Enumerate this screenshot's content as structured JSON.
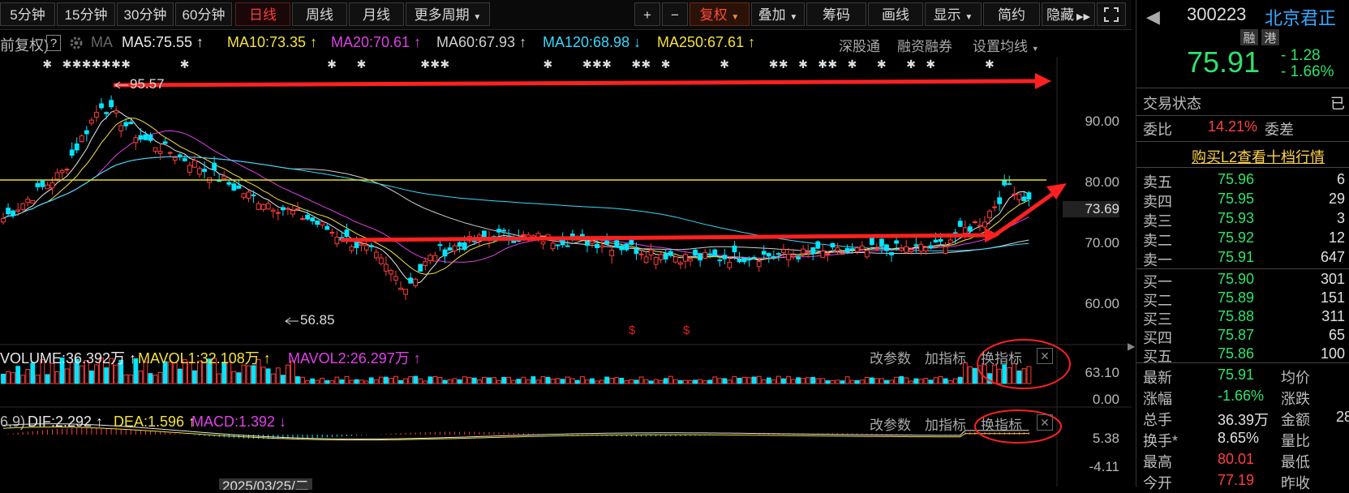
{
  "toolbar": {
    "periods": [
      "5分钟",
      "15分钟",
      "30分钟",
      "60分钟",
      "日线",
      "周线",
      "月线",
      "更多周期"
    ],
    "active_period": "日线",
    "plus": "+",
    "minus": "−",
    "fuquan": "复权",
    "diejia": "叠加",
    "chouma": "筹码",
    "huaxian": "画线",
    "xianshi": "显示",
    "jianyue": "简约",
    "yincang": "隐藏"
  },
  "ma_bar": {
    "prefix": "前复权)",
    "help": "?",
    "ma_label": "MA",
    "items": [
      {
        "text": "MA5:75.55 ↑",
        "color": "#e8e8e8"
      },
      {
        "text": "MA10:73.35 ↑",
        "color": "#f5e13c"
      },
      {
        "text": "MA20:70.61 ↑",
        "color": "#e040e8"
      },
      {
        "text": "MA60:67.93 ↑",
        "color": "#d0d0d0"
      },
      {
        "text": "MA120:68.98 ↓",
        "color": "#38d8ff"
      },
      {
        "text": "MA250:67.61 ↑",
        "color": "#f5e13c"
      }
    ],
    "links": [
      "深股通",
      "融资融券",
      "设置均线"
    ]
  },
  "price_chart": {
    "high_label": "95.57",
    "low_label": "56.85",
    "axis": [
      "90.00",
      "80.00",
      "73.69",
      "70.00",
      "60.00"
    ],
    "s_marks": [
      "$",
      "$"
    ]
  },
  "volume_panel": {
    "items": [
      {
        "text": "VOLUME:36.392万 ↑",
        "color": "#e8e8e8"
      },
      {
        "text": "MAVOL1:32.108万 ↑",
        "color": "#f5e13c"
      },
      {
        "text": "MAVOL2:26.297万 ↑",
        "color": "#e040e8"
      }
    ],
    "buttons": [
      "改参数",
      "加指标",
      "换指标"
    ],
    "axis": [
      "63.10",
      "0.00"
    ]
  },
  "macd_panel": {
    "prefix": "6,9)",
    "items": [
      {
        "text": "DIF:2.292 ↑",
        "color": "#e8e8e8"
      },
      {
        "text": "DEA:1.596 ↑",
        "color": "#f5e13c"
      },
      {
        "text": "MACD:1.392 ↓",
        "color": "#e040e8"
      }
    ],
    "buttons": [
      "改参数",
      "加指标",
      "换指标"
    ],
    "axis": [
      "5.38",
      "-4.11"
    ]
  },
  "date_label": "2025/03/25/二",
  "quote": {
    "code": "300223",
    "name": "北京君正",
    "tags": [
      "融",
      "港"
    ],
    "price": "75.91",
    "change": "- 1.28",
    "change_pct": "- 1.66%",
    "status_label": "交易状态",
    "status_value": "已",
    "weibi_label": "委比",
    "weibi_value": "14.21%",
    "weicha_label": "委差",
    "l2_link": "购买L2查看十档行情",
    "sell": [
      {
        "label": "卖五",
        "price": "75.96",
        "vol": "6"
      },
      {
        "label": "卖四",
        "price": "75.95",
        "vol": "29"
      },
      {
        "label": "卖三",
        "price": "75.93",
        "vol": "3"
      },
      {
        "label": "卖二",
        "price": "75.92",
        "vol": "12"
      },
      {
        "label": "卖一",
        "price": "75.91",
        "vol": "647"
      }
    ],
    "buy": [
      {
        "label": "买一",
        "price": "75.90",
        "vol": "301"
      },
      {
        "label": "买二",
        "price": "75.89",
        "vol": "151"
      },
      {
        "label": "买三",
        "price": "75.88",
        "vol": "311"
      },
      {
        "label": "买四",
        "price": "75.87",
        "vol": "65"
      },
      {
        "label": "买五",
        "price": "75.86",
        "vol": "100"
      }
    ],
    "stats": [
      {
        "l1": "最新",
        "v1": "75.91",
        "c1": "#2ee36b",
        "l2": "均价",
        "v2": ""
      },
      {
        "l1": "涨幅",
        "v1": "-1.66%",
        "c1": "#2ee36b",
        "l2": "涨跌",
        "v2": ""
      },
      {
        "l1": "总手",
        "v1": "36.39万",
        "c1": "#e0e0e0",
        "l2": "金额",
        "v2": "28"
      },
      {
        "l1": "换手*",
        "v1": "8.65%",
        "c1": "#e0e0e0",
        "l2": "量比",
        "v2": ""
      },
      {
        "l1": "最高",
        "v1": "80.01",
        "c1": "#ff4040",
        "l2": "最低",
        "v2": ""
      },
      {
        "l1": "今开",
        "v1": "77.19",
        "c1": "#ff4040",
        "l2": "昨收",
        "v2": ""
      }
    ]
  },
  "colors": {
    "up": "#ff3b3b",
    "down": "#00e5ff",
    "annotation": "#ff2020"
  }
}
